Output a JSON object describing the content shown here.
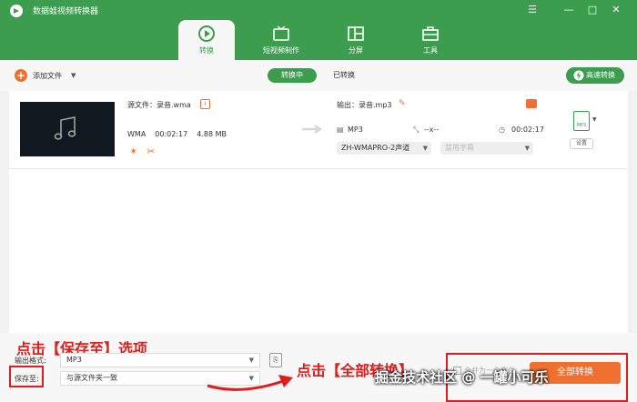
{
  "app": {
    "title": "数据蛙视频转换器"
  },
  "colors": {
    "brand": "#3c9d4f",
    "accent": "#f07030",
    "annotation": "#e01c1c"
  },
  "window_controls": [
    {
      "name": "menu-icon",
      "glyph": "☰"
    },
    {
      "name": "minimize-icon",
      "glyph": "—"
    },
    {
      "name": "maximize-icon",
      "glyph": "□"
    },
    {
      "name": "close-icon",
      "glyph": "✕"
    }
  ],
  "tabs": [
    {
      "label": "转换",
      "icon": "convert-icon",
      "active": true
    },
    {
      "label": "短视频制作",
      "icon": "tv-icon",
      "active": false
    },
    {
      "label": "分屏",
      "icon": "split-screen-icon",
      "active": false
    },
    {
      "label": "工具",
      "icon": "toolbox-icon",
      "active": false
    }
  ],
  "toolbar": {
    "add_files": "添加文件",
    "converting": "转换中",
    "converted": "已转换",
    "fast_convert": "高速转换"
  },
  "file": {
    "source_label": "源文件：录音.wma",
    "source_format": "WMA",
    "duration": "00:02:17",
    "size": "4.88 MB",
    "output_label": "输出：录音.mp3",
    "output_format": "MP3",
    "output_resolution": "--x--",
    "output_duration": "00:02:17",
    "audio_track": "ZH-WMAPRO-2声道",
    "subtitle": "禁用字幕",
    "format_badge": "MP3",
    "settings_button": "设置"
  },
  "footer": {
    "hint_save": "点击【保存至】选项",
    "output_format_label": "输出格式:",
    "output_format_value": "MP3",
    "save_to_label": "保存至:",
    "save_to_value": "与源文件夹一致",
    "hint_convert": "点击【全部转换】",
    "merge_label": "合并为一个文件",
    "convert_all": "全部转换",
    "watermark": "掘金技术社区 @ 一罐小可乐"
  }
}
